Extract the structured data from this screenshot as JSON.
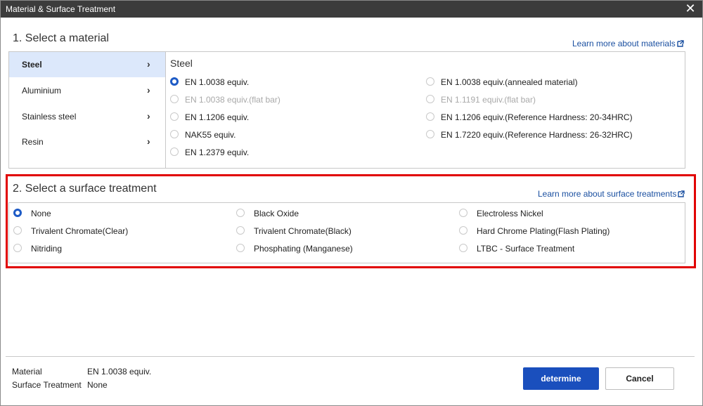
{
  "dialog": {
    "title": "Material & Surface Treatment",
    "close_glyph": "✕"
  },
  "material": {
    "heading": "1. Select a material",
    "learn_more": "Learn more about materials",
    "categories": [
      {
        "label": "Steel",
        "active": true
      },
      {
        "label": "Aluminium",
        "active": false
      },
      {
        "label": "Stainless steel",
        "active": false
      },
      {
        "label": "Resin",
        "active": false
      }
    ],
    "chevron": "›",
    "panel_title": "Steel",
    "options": [
      {
        "label": "EN 1.0038 equiv.",
        "selected": true,
        "disabled": false
      },
      {
        "label": "EN 1.0038 equiv.(flat bar)",
        "selected": false,
        "disabled": true
      },
      {
        "label": "EN 1.1206 equiv.",
        "selected": false,
        "disabled": false
      },
      {
        "label": "NAK55 equiv.",
        "selected": false,
        "disabled": false
      },
      {
        "label": "EN 1.2379 equiv.",
        "selected": false,
        "disabled": false
      },
      {
        "label": "EN 1.0038 equiv.(annealed material)",
        "selected": false,
        "disabled": false
      },
      {
        "label": "EN 1.1191 equiv.(flat bar)",
        "selected": false,
        "disabled": true
      },
      {
        "label": "EN 1.1206 equiv.(Reference Hardness: 20-34HRC)",
        "selected": false,
        "disabled": false
      },
      {
        "label": "EN 1.7220 equiv.(Reference Hardness: 26-32HRC)",
        "selected": false,
        "disabled": false
      }
    ]
  },
  "surface": {
    "heading": "2. Select a surface treatment",
    "learn_more": "Learn more about surface treatments",
    "options": [
      {
        "label": "None",
        "selected": true
      },
      {
        "label": "Trivalent Chromate(Clear)",
        "selected": false
      },
      {
        "label": "Nitriding",
        "selected": false
      },
      {
        "label": "Black Oxide",
        "selected": false
      },
      {
        "label": "Trivalent Chromate(Black)",
        "selected": false
      },
      {
        "label": "Phosphating (Manganese)",
        "selected": false
      },
      {
        "label": "Electroless Nickel",
        "selected": false
      },
      {
        "label": "Hard Chrome Plating(Flash Plating)",
        "selected": false
      },
      {
        "label": "LTBC - Surface Treatment",
        "selected": false
      }
    ]
  },
  "summary": {
    "material_label": "Material",
    "material_value": "EN 1.0038 equiv.",
    "surface_label": "Surface Treatment",
    "surface_value": "None"
  },
  "buttons": {
    "determine": "determine",
    "cancel": "Cancel"
  },
  "colors": {
    "accent": "#1e5bc6",
    "primary_button": "#1a4fbd",
    "highlight_frame": "#e10000",
    "active_nav": "#dce8fb",
    "titlebar": "#3c3c3c"
  }
}
